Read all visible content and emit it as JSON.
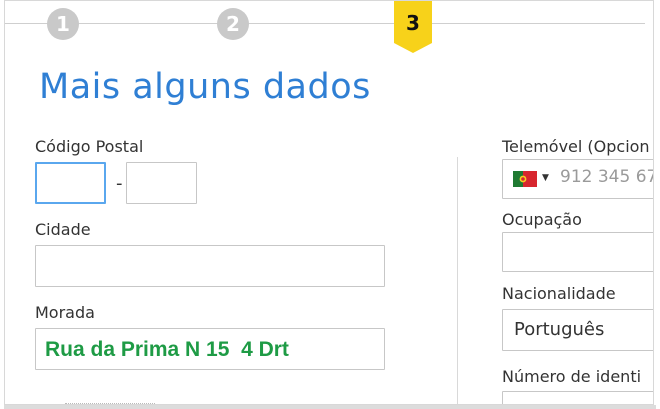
{
  "stepper": {
    "steps": [
      "1",
      "2",
      "3"
    ],
    "active_step": "3",
    "active_color": "#f7d21a",
    "inactive_color": "#c9c9c9"
  },
  "title": "Mais alguns dados",
  "form_left": {
    "codigo_postal": {
      "label": "Código Postal",
      "part1_value": "",
      "part2_value": "",
      "separator": "-"
    },
    "cidade": {
      "label": "Cidade",
      "value": ""
    },
    "morada": {
      "label": "Morada",
      "value": "Rua da Prima N 15  4 Drt"
    }
  },
  "form_right": {
    "telemovel": {
      "label": "Telemóvel (Opcion",
      "country_flag": "portugal-flag-icon",
      "placeholder": "912 345 67"
    },
    "ocupacao": {
      "label": "Ocupação",
      "value": ""
    },
    "nacionalidade": {
      "label": "Nacionalidade",
      "value": "Português"
    },
    "numero_identificacao": {
      "label": "Número de identi"
    }
  },
  "colors": {
    "title": "#2f7fd4",
    "morada_text": "#1e9b45",
    "focus_border": "#5aa7ee"
  }
}
